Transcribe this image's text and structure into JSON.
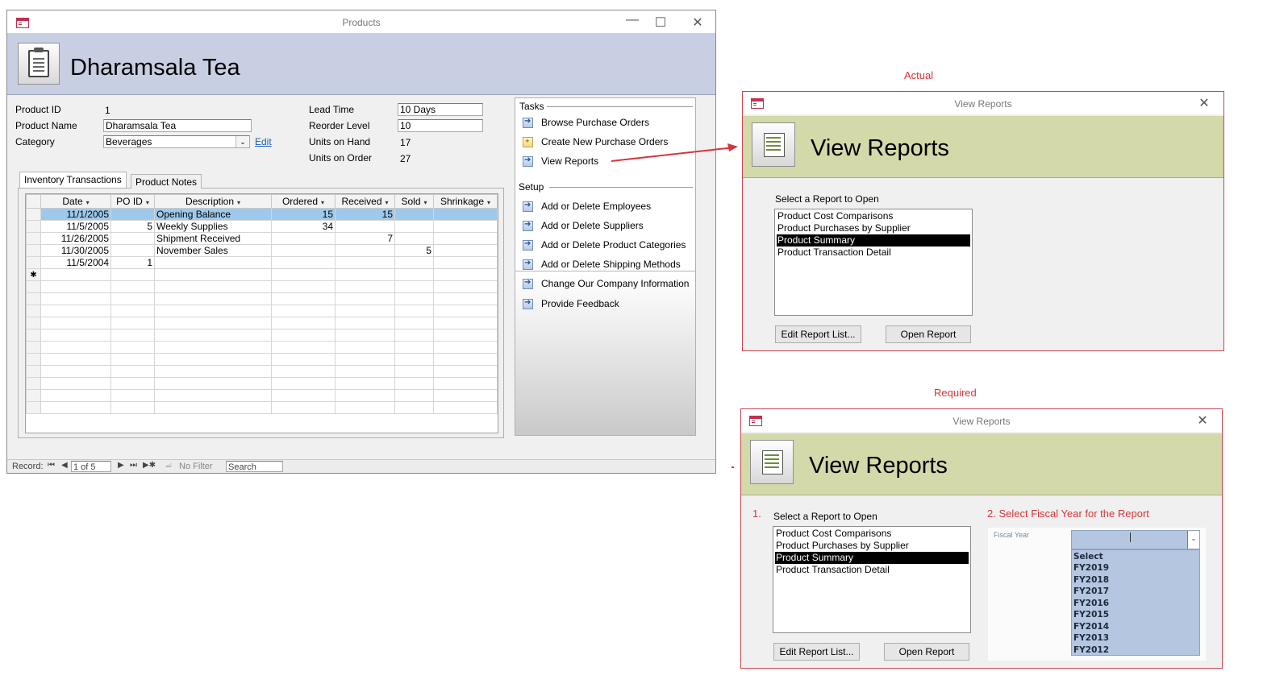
{
  "products_window": {
    "title": "Products",
    "product_name_header": "Dharamsala Tea",
    "fields": {
      "product_id_label": "Product ID",
      "product_id_value": "1",
      "product_name_label": "Product Name",
      "product_name_value": "Dharamsala Tea",
      "category_label": "Category",
      "category_value": "Beverages",
      "edit_link": "Edit",
      "lead_time_label": "Lead Time",
      "lead_time_value": "10 Days",
      "reorder_level_label": "Reorder Level",
      "reorder_level_value": "10",
      "units_on_hand_label": "Units on Hand",
      "units_on_hand_value": "17",
      "units_on_order_label": "Units on Order",
      "units_on_order_value": "27"
    },
    "tabs": [
      "Inventory Transactions",
      "Product Notes"
    ],
    "grid": {
      "columns": [
        "Date",
        "PO ID",
        "Description",
        "Ordered",
        "Received",
        "Sold",
        "Shrinkage"
      ],
      "rows": [
        {
          "date": "11/1/2005",
          "po_id": "",
          "description": "Opening Balance",
          "ordered": "15",
          "received": "15",
          "sold": "",
          "shrinkage": ""
        },
        {
          "date": "11/5/2005",
          "po_id": "5",
          "description": "Weekly Supplies",
          "ordered": "34",
          "received": "",
          "sold": "",
          "shrinkage": ""
        },
        {
          "date": "11/26/2005",
          "po_id": "",
          "description": "Shipment Received",
          "ordered": "",
          "received": "7",
          "sold": "",
          "shrinkage": ""
        },
        {
          "date": "11/30/2005",
          "po_id": "",
          "description": "November Sales",
          "ordered": "",
          "received": "",
          "sold": "5",
          "shrinkage": ""
        },
        {
          "date": "11/5/2004",
          "po_id": "1",
          "description": "",
          "ordered": "",
          "received": "",
          "sold": "",
          "shrinkage": ""
        }
      ],
      "new_row_marker": "✱"
    },
    "nav": {
      "tasks_label": "Tasks",
      "tasks": [
        "Browse Purchase Orders",
        "Create New Purchase Orders",
        "View Reports"
      ],
      "setup_label": "Setup",
      "setup": [
        "Add or Delete Employees",
        "Add or Delete Suppliers",
        "Add or Delete Product Categories",
        "Add or Delete Shipping Methods"
      ],
      "other": [
        "Change Our Company Information",
        "Provide Feedback"
      ]
    },
    "status": {
      "record_label": "Record:",
      "record_value": "1 of 5",
      "filter": "No Filter",
      "search": "Search"
    }
  },
  "actual": {
    "caption": "Actual",
    "title": "View Reports",
    "header": "View Reports",
    "list_label": "Select a Report to Open",
    "reports": [
      "Product Cost Comparisons",
      "Product Purchases by Supplier",
      "Product Summary",
      "Product Transaction Detail"
    ],
    "selected_index": 2,
    "edit_button": "Edit Report List...",
    "open_button": "Open Report"
  },
  "required": {
    "caption": "Required",
    "title": "View Reports",
    "header": "View Reports",
    "step1": "1.",
    "list_label": "Select a Report to Open",
    "reports": [
      "Product Cost Comparisons",
      "Product Purchases by Supplier",
      "Product Summary",
      "Product Transaction Detail"
    ],
    "selected_index": 2,
    "edit_button": "Edit Report List...",
    "open_button": "Open Report",
    "step2": "2. Select Fiscal Year for the Report",
    "fiscal_label": "Fiscal Year",
    "fiscal_options": [
      "Select",
      "FY2019",
      "FY2018",
      "FY2017",
      "FY2016",
      "FY2015",
      "FY2014",
      "FY2013",
      "FY2012"
    ]
  },
  "colors": {
    "accent_red": "#d8343a",
    "products_header": "#c9cfe3",
    "reports_header": "#d3d9a9",
    "selection_blue": "#9ec9ec",
    "dropdown_bg": "#b4c6e0"
  }
}
